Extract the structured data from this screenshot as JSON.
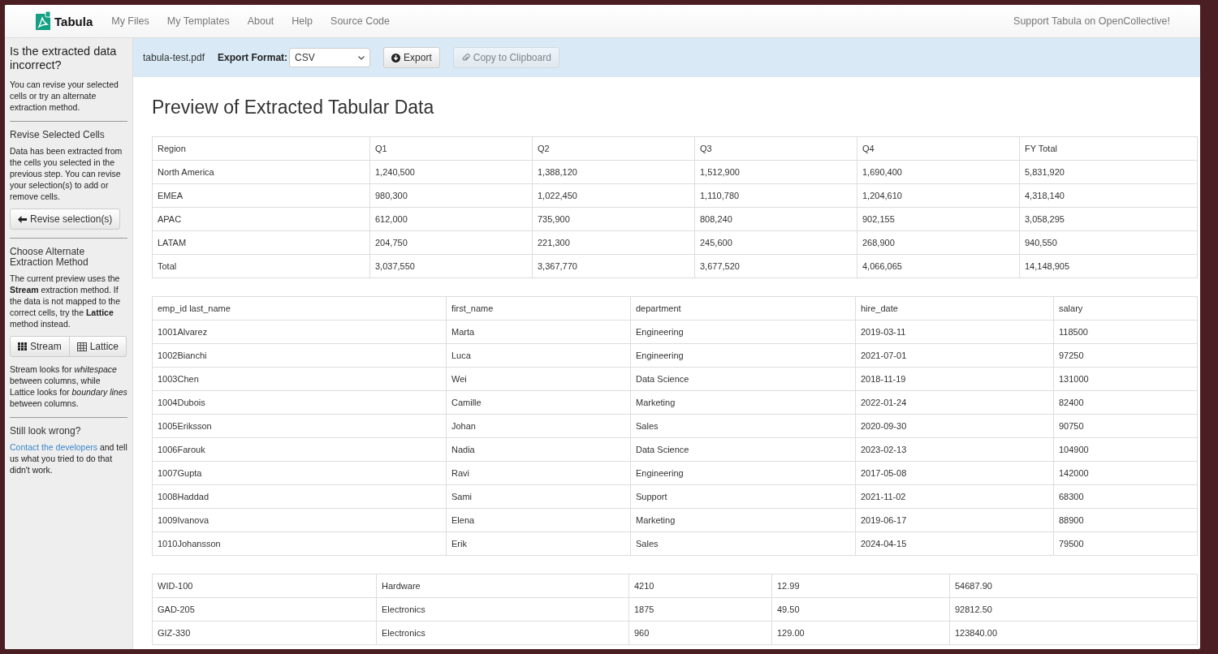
{
  "navbar": {
    "brand": "Tabula",
    "links": [
      "My Files",
      "My Templates",
      "About",
      "Help",
      "Source Code"
    ],
    "support_link": "Support Tabula on OpenCollective!"
  },
  "sidebar": {
    "title": "Is the extracted data incorrect?",
    "intro": "You can revise your selected cells or try an alternate extraction method.",
    "sections": [
      {
        "heading": "Revise Selected Cells",
        "text": "Data has been extracted from the cells you selected in the previous step. You can revise your selection(s) to add or remove cells.",
        "kind": "revise",
        "button": "Revise selection(s)"
      },
      {
        "heading": "Choose Alternate Extraction Method",
        "text": "The current preview uses the **Stream** extraction method. If the data is not mapped to the correct cells, try the **Lattice** method instead.",
        "kind": "methods",
        "methods": [
          {
            "label": "Stream",
            "kind": "stream"
          },
          {
            "label": "Lattice",
            "kind": "lattice"
          }
        ],
        "note": "Stream looks for *whitespace* between columns, while Lattice looks for *boundary lines* between columns."
      },
      {
        "heading": "Still look wrong?",
        "kind": "contact",
        "link": "Contact the developers",
        "text": " and tell us what you tried to do that didn't work."
      }
    ]
  },
  "toolbar": {
    "filename": "tabula-test.pdf",
    "format_label": "Export Format:",
    "format_value": "CSV",
    "export_button": "Export",
    "copy_button": "Copy to Clipboard",
    "copy_disabled": true
  },
  "preview": {
    "title": "Preview of Extracted Tabular Data",
    "tables": [
      {
        "rows": [
          [
            "Region",
            "Q1",
            "Q2",
            "Q3",
            "Q4",
            "FY Total"
          ],
          [
            "North America",
            "1,240,500",
            "1,388,120",
            "1,512,900",
            "1,690,400",
            "5,831,920"
          ],
          [
            "EMEA",
            "980,300",
            "1,022,450",
            "1,110,780",
            "1,204,610",
            "4,318,140"
          ],
          [
            "APAC",
            "612,000",
            "735,900",
            "808,240",
            "902,155",
            "3,058,295"
          ],
          [
            "LATAM",
            "204,750",
            "221,300",
            "245,600",
            "268,900",
            "940,550"
          ],
          [
            "Total",
            "3,037,550",
            "3,367,770",
            "3,677,520",
            "4,066,065",
            "14,148,905"
          ]
        ]
      },
      {
        "rows": [
          [
            "emp_id last_name",
            "first_name",
            "department",
            "hire_date",
            "salary"
          ],
          [
            "1001Alvarez",
            "Marta",
            "Engineering",
            "2019-03-11",
            "118500"
          ],
          [
            "1002Bianchi",
            "Luca",
            "Engineering",
            "2021-07-01",
            "97250"
          ],
          [
            "1003Chen",
            "Wei",
            "Data Science",
            "2018-11-19",
            "131000"
          ],
          [
            "1004Dubois",
            "Camille",
            "Marketing",
            "2022-01-24",
            "82400"
          ],
          [
            "1005Eriksson",
            "Johan",
            "Sales",
            "2020-09-30",
            "90750"
          ],
          [
            "1006Farouk",
            "Nadia",
            "Data Science",
            "2023-02-13",
            "104900"
          ],
          [
            "1007Gupta",
            "Ravi",
            "Engineering",
            "2017-05-08",
            "142000"
          ],
          [
            "1008Haddad",
            "Sami",
            "Support",
            "2021-11-02",
            "68300"
          ],
          [
            "1009Ivanova",
            "Elena",
            "Marketing",
            "2019-06-17",
            "88900"
          ],
          [
            "1010Johansson",
            "Erik",
            "Sales",
            "2024-04-15",
            "79500"
          ]
        ]
      },
      {
        "rows": [
          [
            "WID-100",
            "Hardware",
            "4210",
            "12.99",
            "54687.90"
          ],
          [
            "GAD-205",
            "Electronics",
            "1875",
            "49.50",
            "92812.50"
          ],
          [
            "GIZ-330",
            "Electronics",
            "960",
            "129.00",
            "123840.00"
          ]
        ]
      }
    ]
  }
}
